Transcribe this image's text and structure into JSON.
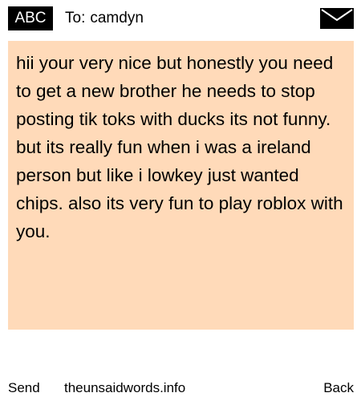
{
  "header": {
    "badge_label": "ABC",
    "to_prefix": "To:",
    "recipient": "camdyn",
    "envelope_icon": "envelope-icon"
  },
  "message": {
    "text": "hii your very nice but honestly you need to get a new brother he needs to stop posting tik toks with ducks its not funny. but its really fun when i was a ireland person but like i lowkey just wanted chips. also its very fun to play roblox with you.",
    "background_color": "#ffdab9"
  },
  "footer": {
    "send_label": "Send",
    "site_label": "theunsaidwords.info",
    "back_label": "Back"
  }
}
